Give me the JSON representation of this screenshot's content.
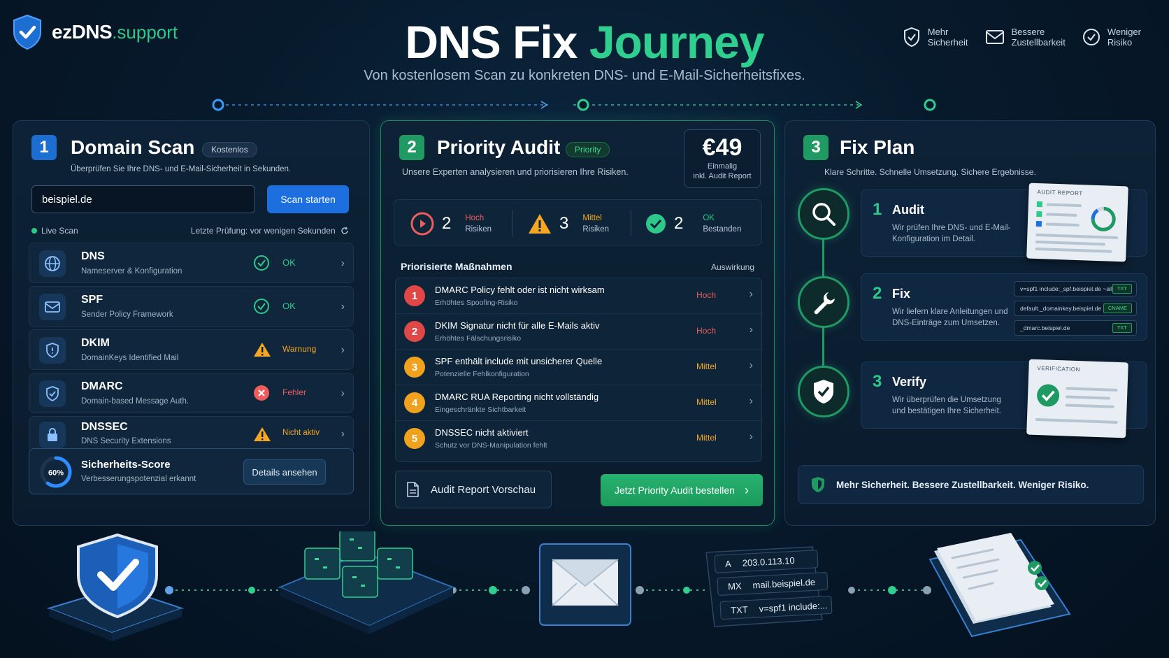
{
  "brand": {
    "name": "ezDNS",
    "tld": ".support"
  },
  "header": {
    "title_part1": "DNS Fix",
    "title_part2": "Journey",
    "subtitle": "Von kostenlosem Scan zu konkreten DNS- und E-Mail-Sicherheitsfixes.",
    "perks": [
      {
        "line1": "Mehr",
        "line2": "Sicherheit",
        "icon": "shield-check-icon"
      },
      {
        "line1": "Bessere",
        "line2": "Zustellbarkeit",
        "icon": "mail-icon"
      },
      {
        "line1": "Weniger",
        "line2": "Risiko",
        "icon": "check-circle-icon"
      }
    ]
  },
  "colors": {
    "accent_green": "#2ec98a",
    "accent_blue": "#1d6fe0",
    "warning": "#f5a623",
    "error": "#ef5c5c"
  },
  "scan": {
    "step": "1",
    "title": "Domain Scan",
    "badge": "Kostenlos",
    "desc": "Überprüfen Sie Ihre DNS- und E-Mail-Sicherheit in Sekunden.",
    "input_value": "beispiel.de",
    "button": "Scan starten",
    "live": "Live Scan",
    "last_check": "Letzte Prüfung: vor wenigen Sekunden",
    "checks": [
      {
        "name": "DNS",
        "sub": "Nameserver & Konfiguration",
        "status": "OK",
        "icon": "globe-icon",
        "level": "ok"
      },
      {
        "name": "SPF",
        "sub": "Sender Policy Framework",
        "status": "OK",
        "icon": "mail-icon",
        "level": "ok"
      },
      {
        "name": "DKIM",
        "sub": "DomainKeys Identified Mail",
        "status": "Warnung",
        "icon": "shield-icon",
        "level": "warn"
      },
      {
        "name": "DMARC",
        "sub": "Domain-based Message Auth.",
        "status": "Fehler",
        "icon": "shield-check-icon",
        "level": "err"
      },
      {
        "name": "DNSSEC",
        "sub": "DNS Security Extensions",
        "status": "Nicht aktiv",
        "icon": "lock-icon",
        "level": "warn"
      }
    ],
    "score": {
      "value": "60%",
      "fraction": 0.6,
      "title": "Sicherheits-Score",
      "sub": "Verbesserungspotenzial erkannt",
      "button": "Details ansehen"
    }
  },
  "audit": {
    "step": "2",
    "title": "Priority Audit",
    "badge": "Priority",
    "desc": "Unsere Experten analysieren und priorisieren Ihre Risiken.",
    "price": "€49",
    "price_l1": "Einmalig",
    "price_l2": "inkl. Audit Report",
    "risks": [
      {
        "count": "2",
        "label1": "Hoch",
        "label2": "Risiken",
        "level": "hoch"
      },
      {
        "count": "3",
        "label1": "Mittel",
        "label2": "Risiken",
        "level": "mittel"
      },
      {
        "count": "2",
        "label1": "OK",
        "label2": "Bestanden",
        "level": "ok"
      }
    ],
    "list_head": "Priorisierte Maßnahmen",
    "impact_head": "Auswirkung",
    "items": [
      {
        "num": "1",
        "title": "DMARC Policy fehlt oder ist nicht wirksam",
        "sub": "Erhöhtes Spoofing-Risiko",
        "impact": "Hoch",
        "level": "hoch"
      },
      {
        "num": "2",
        "title": "DKIM Signatur nicht für alle E-Mails aktiv",
        "sub": "Erhöhtes Fälschungsrisiko",
        "impact": "Hoch",
        "level": "hoch"
      },
      {
        "num": "3",
        "title": "SPF enthält include mit unsicherer Quelle",
        "sub": "Potenzielle Fehlkonfiguration",
        "impact": "Mittel",
        "level": "mittel"
      },
      {
        "num": "4",
        "title": "DMARC RUA Reporting nicht vollständig",
        "sub": "Eingeschränkte Sichtbarkeit",
        "impact": "Mittel",
        "level": "mittel"
      },
      {
        "num": "5",
        "title": "DNSSEC nicht aktiviert",
        "sub": "Schutz vor DNS-Manipulation fehlt",
        "impact": "Mittel",
        "level": "mittel"
      }
    ],
    "preview_button": "Audit Report Vorschau",
    "order_button": "Jetzt Priority Audit bestellen"
  },
  "fix": {
    "step": "3",
    "title": "Fix Plan",
    "desc": "Klare Schritte. Schnelle Umsetzung. Sichere Ergebnisse.",
    "steps": [
      {
        "num": "1",
        "title": "Audit",
        "desc": "Wir prüfen Ihre DNS- und E-Mail-Konfiguration im Detail.",
        "icon": "search-icon",
        "doc_label": "AUDIT REPORT"
      },
      {
        "num": "2",
        "title": "Fix",
        "desc": "Wir liefern klare Anleitungen und DNS-Einträge zum Umsetzen.",
        "icon": "wrench-icon"
      },
      {
        "num": "3",
        "title": "Verify",
        "desc": "Wir überprüfen die Umsetzung und bestätigen Ihre Sicherheit.",
        "icon": "shield-check-icon",
        "doc_label": "VERIFICATION"
      }
    ],
    "records": [
      {
        "value": "v=spf1 include:_spf.beispiel.de ~all",
        "type": "TXT"
      },
      {
        "value": "default._domainkey.beispiel.de",
        "type": "CNAME"
      },
      {
        "value": "_dmarc.beispiel.de",
        "type": "TXT"
      }
    ],
    "footer": "Mehr Sicherheit. Bessere Zustellbarkeit. Weniger Risiko."
  },
  "bottom": {
    "dns_records": [
      {
        "type": "A",
        "value": "203.0.113.10"
      },
      {
        "type": "MX",
        "value": "mail.beispiel.de"
      },
      {
        "type": "TXT",
        "value": "v=spf1 include:..."
      }
    ]
  }
}
